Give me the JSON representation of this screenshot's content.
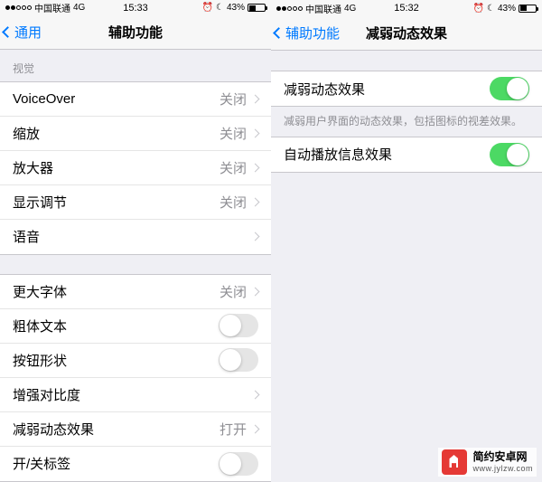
{
  "left": {
    "status": {
      "carrier": "中国联通",
      "network": "4G",
      "time": "15:33",
      "battery": "43%"
    },
    "nav": {
      "back": "通用",
      "title": "辅助功能"
    },
    "section1_header": "视觉",
    "section1": [
      {
        "label": "VoiceOver",
        "value": "关闭"
      },
      {
        "label": "缩放",
        "value": "关闭"
      },
      {
        "label": "放大器",
        "value": "关闭"
      },
      {
        "label": "显示调节",
        "value": "关闭"
      },
      {
        "label": "语音",
        "value": ""
      }
    ],
    "section2": [
      {
        "label": "更大字体",
        "value": "关闭",
        "kind": "value"
      },
      {
        "label": "粗体文本",
        "kind": "toggle",
        "on": false
      },
      {
        "label": "按钮形状",
        "kind": "toggle",
        "on": false
      },
      {
        "label": "增强对比度",
        "kind": "value",
        "value": ""
      },
      {
        "label": "减弱动态效果",
        "kind": "value",
        "value": "打开"
      },
      {
        "label": "开/关标签",
        "kind": "toggle",
        "on": false
      }
    ]
  },
  "right": {
    "status": {
      "carrier": "中国联通",
      "network": "4G",
      "time": "15:32",
      "battery": "43%"
    },
    "nav": {
      "back": "辅助功能",
      "title": "减弱动态效果"
    },
    "rows": [
      {
        "label": "减弱动态效果",
        "on": true
      }
    ],
    "footer": "减弱用户界面的动态效果，包括图标的视差效果。",
    "rows2": [
      {
        "label": "自动播放信息效果",
        "on": true
      }
    ]
  },
  "watermark": {
    "title": "简约安卓网",
    "url": "www.jylzw.com"
  }
}
